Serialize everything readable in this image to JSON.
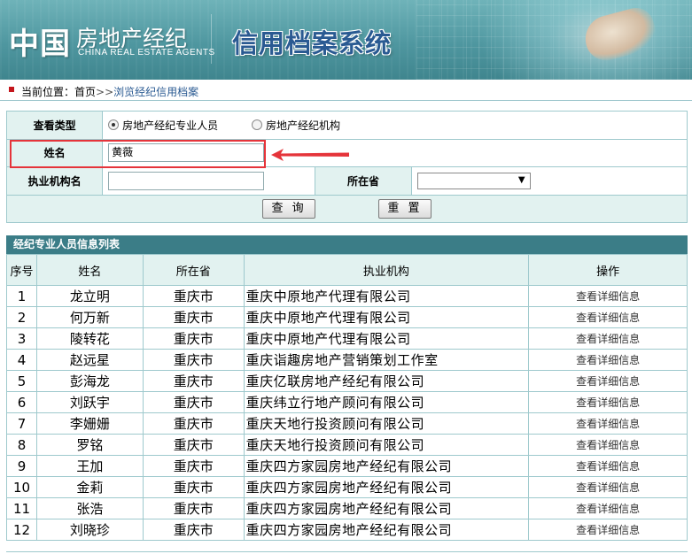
{
  "header": {
    "logo_main": "中国",
    "logo_sub": "房地产经纪",
    "logo_en": "CHINA REAL ESTATE AGENTS",
    "system_title": "信用档案系统"
  },
  "breadcrumb": {
    "label": "当前位置：",
    "home": "首页",
    "separator": ">>",
    "current": "浏览经纪信用档案"
  },
  "search": {
    "type_label": "查看类型",
    "type_options": [
      {
        "label": "房地产经纪专业人员",
        "selected": true
      },
      {
        "label": "房地产经纪机构",
        "selected": false
      }
    ],
    "name_label": "姓名",
    "name_value": "黄薇",
    "org_label": "执业机构名",
    "org_value": "",
    "province_label": "所在省",
    "province_value": "",
    "query_button": "查 询",
    "reset_button": "重 置"
  },
  "list": {
    "title": "经纪专业人员信息列表",
    "columns": [
      "序号",
      "姓名",
      "所在省",
      "执业机构",
      "操作"
    ],
    "action_label": "查看详细信息",
    "rows": [
      {
        "no": "1",
        "name": "龙立明",
        "province": "重庆市",
        "org": "重庆中原地产代理有限公司"
      },
      {
        "no": "2",
        "name": "何万新",
        "province": "重庆市",
        "org": "重庆中原地产代理有限公司"
      },
      {
        "no": "3",
        "name": "陵转花",
        "province": "重庆市",
        "org": "重庆中原地产代理有限公司"
      },
      {
        "no": "4",
        "name": "赵远星",
        "province": "重庆市",
        "org": "重庆诣趣房地产营销策划工作室"
      },
      {
        "no": "5",
        "name": "彭海龙",
        "province": "重庆市",
        "org": "重庆亿联房地产经纪有限公司"
      },
      {
        "no": "6",
        "name": "刘跃宇",
        "province": "重庆市",
        "org": "重庆纬立行地产顾问有限公司"
      },
      {
        "no": "7",
        "name": "李姗姗",
        "province": "重庆市",
        "org": "重庆天地行投资顾问有限公司"
      },
      {
        "no": "8",
        "name": "罗铭",
        "province": "重庆市",
        "org": "重庆天地行投资顾问有限公司"
      },
      {
        "no": "9",
        "name": "王加",
        "province": "重庆市",
        "org": "重庆四方家园房地产经纪有限公司"
      },
      {
        "no": "10",
        "name": "金莉",
        "province": "重庆市",
        "org": "重庆四方家园房地产经纪有限公司"
      },
      {
        "no": "11",
        "name": "张浩",
        "province": "重庆市",
        "org": "重庆四方家园房地产经纪有限公司"
      },
      {
        "no": "12",
        "name": "刘晓珍",
        "province": "重庆市",
        "org": "重庆四方家园房地产经纪有限公司"
      }
    ]
  },
  "colors": {
    "accent_teal": "#3b7d87",
    "label_bg": "#e2f2f0",
    "highlight_red": "#e5343a",
    "title_blue": "#2a5a92"
  }
}
